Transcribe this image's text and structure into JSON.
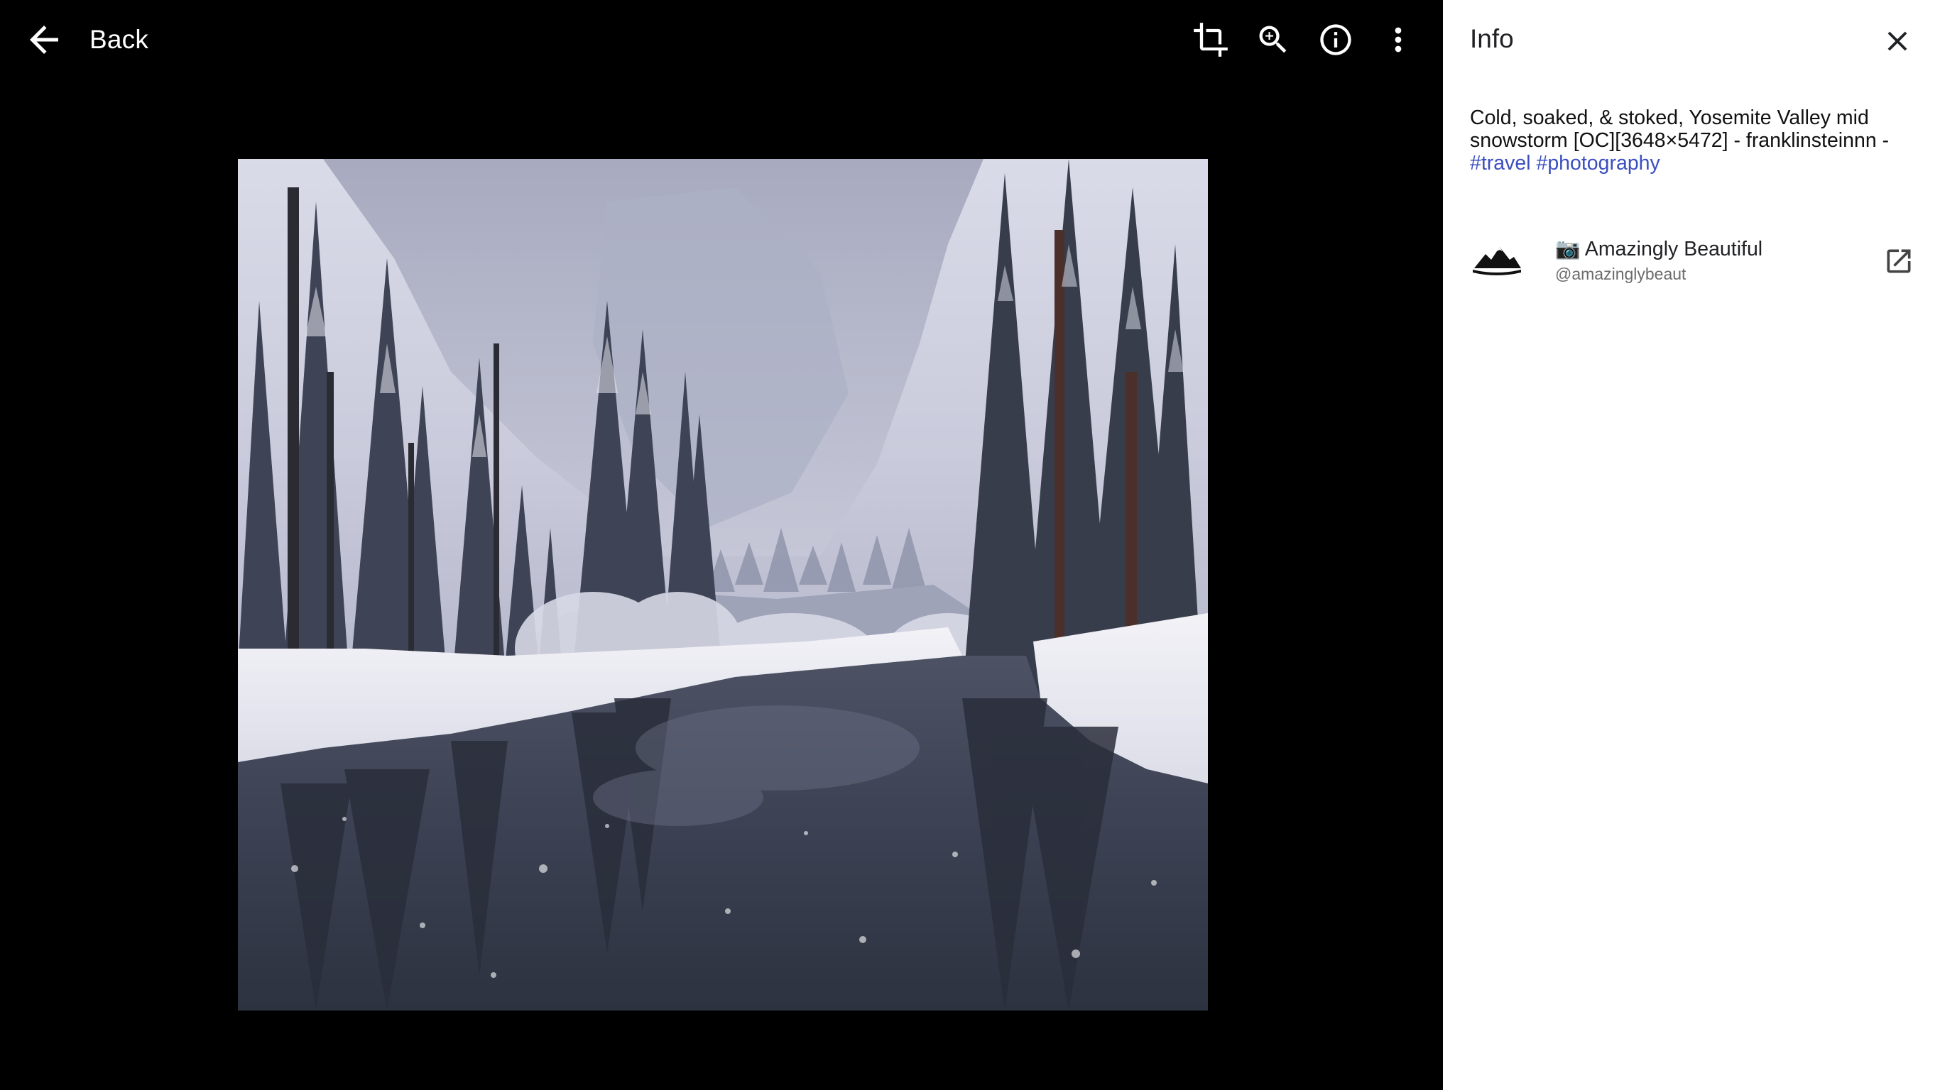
{
  "topbar": {
    "back_label": "Back",
    "tools": [
      {
        "icon": "crop-icon"
      },
      {
        "icon": "zoom-in-icon"
      },
      {
        "icon": "info-icon"
      },
      {
        "icon": "more-vert-icon"
      }
    ]
  },
  "photo": {
    "subject": "snowy river landscape"
  },
  "info_panel": {
    "title": "Info",
    "description": "Cold, soaked, & stoked, Yosemite Valley mid snowstorm [OC][3648×5472] - franklinsteinnn -",
    "tags": [
      "#travel",
      "#photography"
    ],
    "author": {
      "name": "📷 Amazingly Beautiful",
      "handle": "@amazinglybeaut"
    }
  },
  "colors": {
    "viewer_bg": "#000000",
    "panel_bg": "#ffffff",
    "link": "#3b4fbf",
    "icon_dark": "#444444"
  }
}
